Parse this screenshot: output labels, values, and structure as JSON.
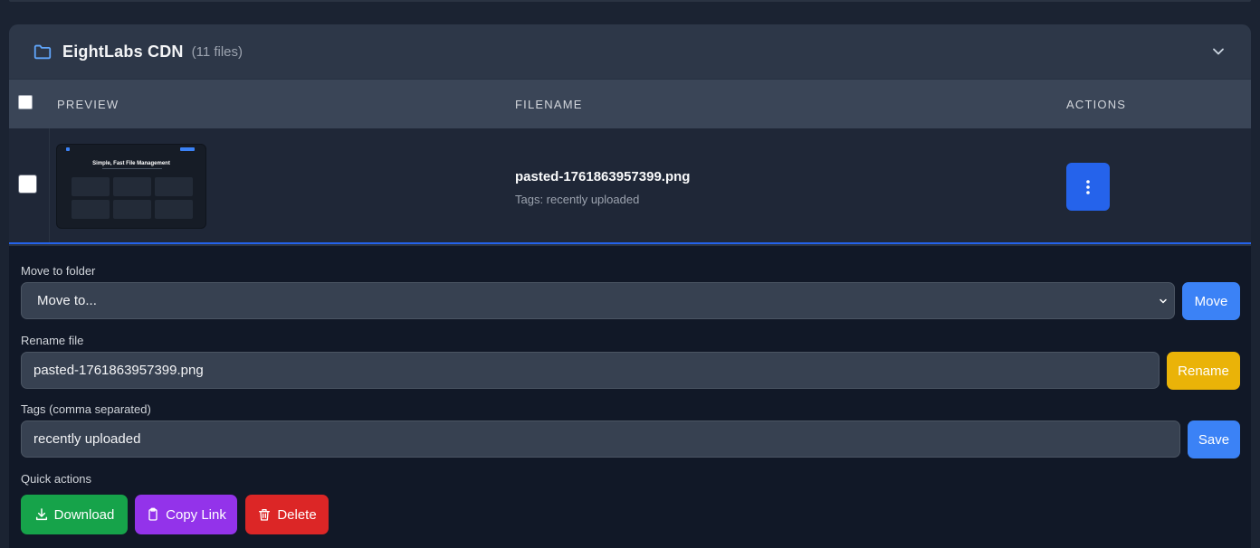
{
  "folder": {
    "name": "EightLabs CDN",
    "count": "(11 files)",
    "color": "#60a5fa"
  },
  "table": {
    "headers": {
      "preview": "PREVIEW",
      "filename": "FILENAME",
      "actions": "ACTIONS"
    }
  },
  "file": {
    "name": "pasted-1761863957399.png",
    "tags_label": "Tags: recently uploaded",
    "thumbnail_title": "Simple, Fast File Management"
  },
  "editor": {
    "move": {
      "label": "Move to folder",
      "selected": "Move to...",
      "button": "Move"
    },
    "rename": {
      "label": "Rename file",
      "value": "pasted-1761863957399.png",
      "button": "Rename"
    },
    "tags": {
      "label": "Tags (comma separated)",
      "value": "recently uploaded",
      "button": "Save"
    },
    "quick": {
      "label": "Quick actions",
      "download": "Download",
      "copy_link": "Copy Link",
      "delete": "Delete"
    }
  },
  "colors": {
    "primary": "#2563eb",
    "move_button": "#3b82f6",
    "rename_button": "#eab308",
    "download_button": "#16a34a",
    "copy_button": "#9333ea",
    "delete_button": "#dc2626"
  }
}
